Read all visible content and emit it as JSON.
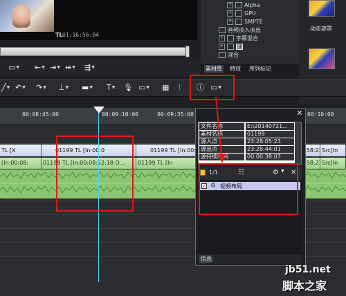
{
  "preview": {
    "track_label": "TL",
    "timecode": "01:16:56:04"
  },
  "effects_tree": {
    "items": [
      {
        "label": "Alpha",
        "expand": "+"
      },
      {
        "label": "GPU",
        "expand": "+"
      },
      {
        "label": "SMPTE",
        "expand": "+"
      },
      {
        "label": "音频淡入淡出",
        "expand": ""
      },
      {
        "label": "字幕混合",
        "expand": "+"
      },
      {
        "label": "键",
        "expand": "+"
      },
      {
        "label": "混合",
        "expand": ""
      }
    ],
    "tabs": [
      "素材库",
      "特效",
      "序列标记"
    ],
    "thumb_caption": "动态遮罩"
  },
  "ruler": {
    "ticks": [
      "00:08:45:00",
      "00:09:10:00",
      "00:09:35:00",
      "00:10:00"
    ]
  },
  "video_track": {
    "clips": [
      "TL [X",
      "01199 TL [In:00:0",
      "01199 TL [In:00:0",
      "01199 TL [In:00:0",
      ":58:23]",
      "Src[In"
    ]
  },
  "audio_track": {
    "clips": [
      "[In:00:08:",
      "01199 TL [In:00:08:52:18 O...",
      "01199 TL [In",
      ":58:23]",
      "Src[In"
    ]
  },
  "info_panel": {
    "rows": [
      {
        "key": "文件名称",
        "value": "E:\\20140721..."
      },
      {
        "key": "素材名称",
        "value": "01199"
      },
      {
        "key": "源入点",
        "value": "23:28:05:23"
      },
      {
        "key": "源出点",
        "value": "23:28:44:01"
      },
      {
        "key": "源持续时间",
        "value": "00:00:38:03"
      }
    ],
    "page_indicator": "1/1",
    "list_item": "视频布局",
    "footer_label": "信息"
  },
  "watermark": {
    "site": "jb51.net",
    "name": "脚本之家"
  },
  "colors": {
    "highlight": "#e01818",
    "playhead": "#4fd3f0",
    "video_clip": "#c6d2ea",
    "audio_clip": "#8ac572"
  }
}
